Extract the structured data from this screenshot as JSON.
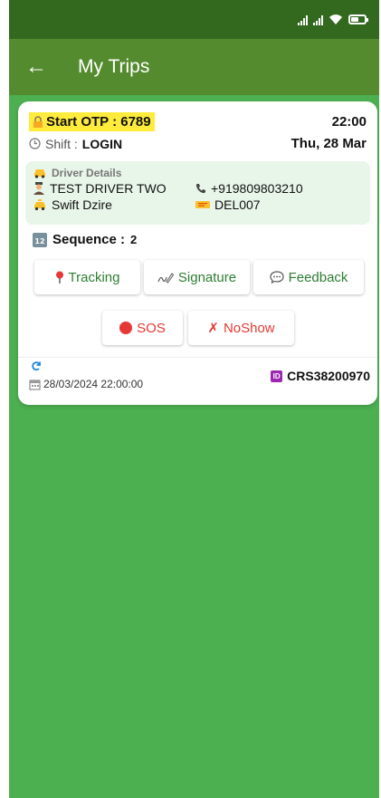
{
  "app_bar": {
    "title": "My Trips"
  },
  "trip": {
    "otp_label": "Start OTP : 6789",
    "time": "22:00",
    "shift_label": "Shift :",
    "shift_value": "LOGIN",
    "date": "Thu, 28 Mar",
    "driver_details_label": "Driver Details",
    "driver_name": "TEST DRIVER TWO",
    "driver_phone": "+919809803210",
    "vehicle_model": "Swift Dzire",
    "vehicle_number": "DEL007",
    "sequence_label": "Sequence :",
    "sequence_value": "2",
    "trip_datetime": "28/03/2024 22:00:00",
    "trip_id": "CRS38200970"
  },
  "actions": {
    "tracking": "Tracking",
    "signature": "Signature",
    "feedback": "Feedback",
    "sos": "SOS",
    "noshow": "NoShow"
  },
  "colors": {
    "status_bar": "#33691e",
    "app_bar": "#558b2f",
    "background": "#4caf50",
    "otp_highlight": "#ffeb3b",
    "driver_panel": "#e8f5e9",
    "action_text": "#2e7d32",
    "danger": "#e53935"
  }
}
